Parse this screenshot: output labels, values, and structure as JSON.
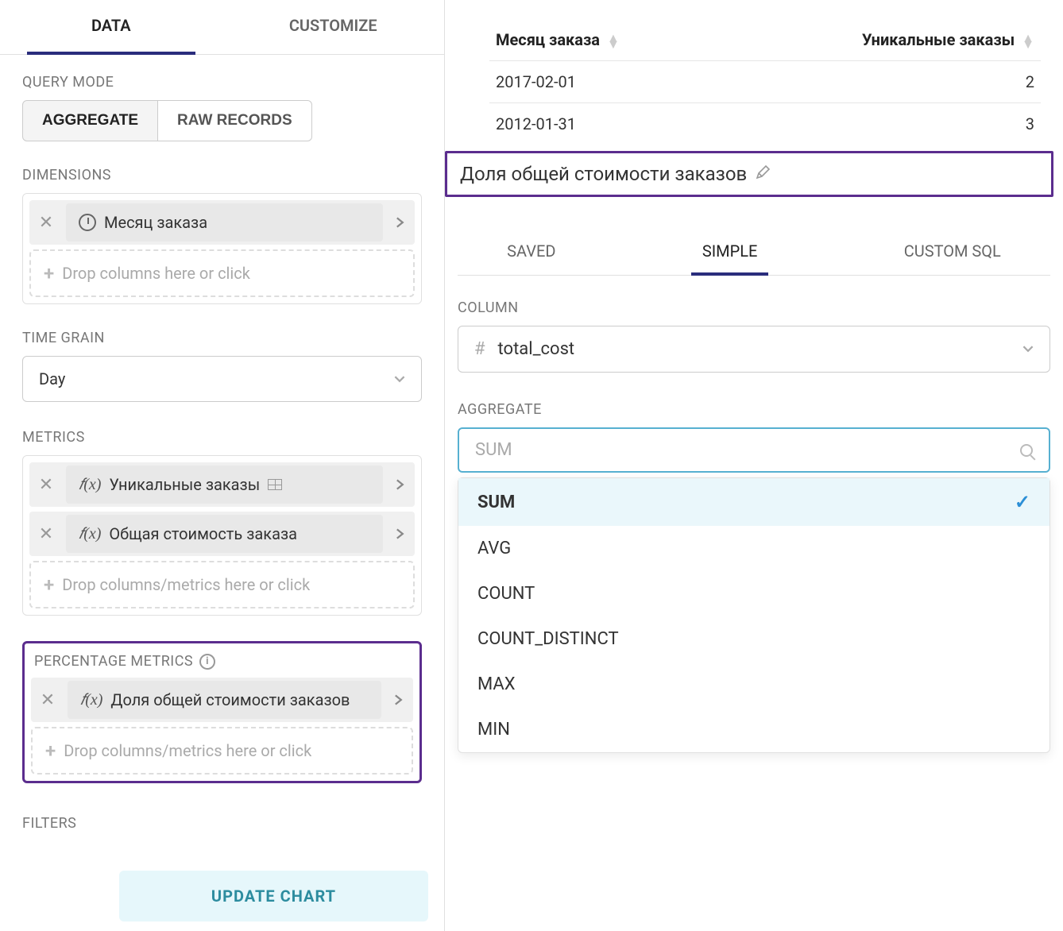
{
  "top_tabs": {
    "data": "DATA",
    "customize": "CUSTOMIZE"
  },
  "query_mode": {
    "label": "QUERY MODE",
    "aggregate": "AGGREGATE",
    "raw_records": "RAW RECORDS"
  },
  "dimensions": {
    "label": "DIMENSIONS",
    "items": [
      {
        "name": "Месяц заказа"
      }
    ],
    "drop_hint": "Drop columns here or click"
  },
  "time_grain": {
    "label": "TIME GRAIN",
    "value": "Day"
  },
  "metrics": {
    "label": "METRICS",
    "items": [
      {
        "name": "Уникальные заказы",
        "has_badge": true
      },
      {
        "name": "Общая стоимость заказа",
        "has_badge": false
      }
    ],
    "drop_hint": "Drop columns/metrics here or click"
  },
  "percentage_metrics": {
    "label": "PERCENTAGE METRICS",
    "items": [
      {
        "name": "Доля общей стоимости заказов"
      }
    ],
    "drop_hint": "Drop columns/metrics here or click"
  },
  "filters": {
    "label": "FILTERS"
  },
  "update_button": "UPDATE CHART",
  "table": {
    "headers": {
      "col1": "Месяц заказа",
      "col2": "Уникальные заказы"
    },
    "rows": [
      {
        "c1": "2017-02-01",
        "c2": "2"
      },
      {
        "c1": "2012-01-31",
        "c2": "3"
      }
    ]
  },
  "metric_editor": {
    "title": "Доля общей стоимости заказов",
    "tabs": {
      "saved": "SAVED",
      "simple": "SIMPLE",
      "custom_sql": "CUSTOM SQL"
    },
    "column": {
      "label": "COLUMN",
      "value": "total_cost"
    },
    "aggregate": {
      "label": "AGGREGATE",
      "placeholder": "SUM",
      "options": [
        "SUM",
        "AVG",
        "COUNT",
        "COUNT_DISTINCT",
        "MAX",
        "MIN"
      ],
      "selected": "SUM"
    }
  }
}
